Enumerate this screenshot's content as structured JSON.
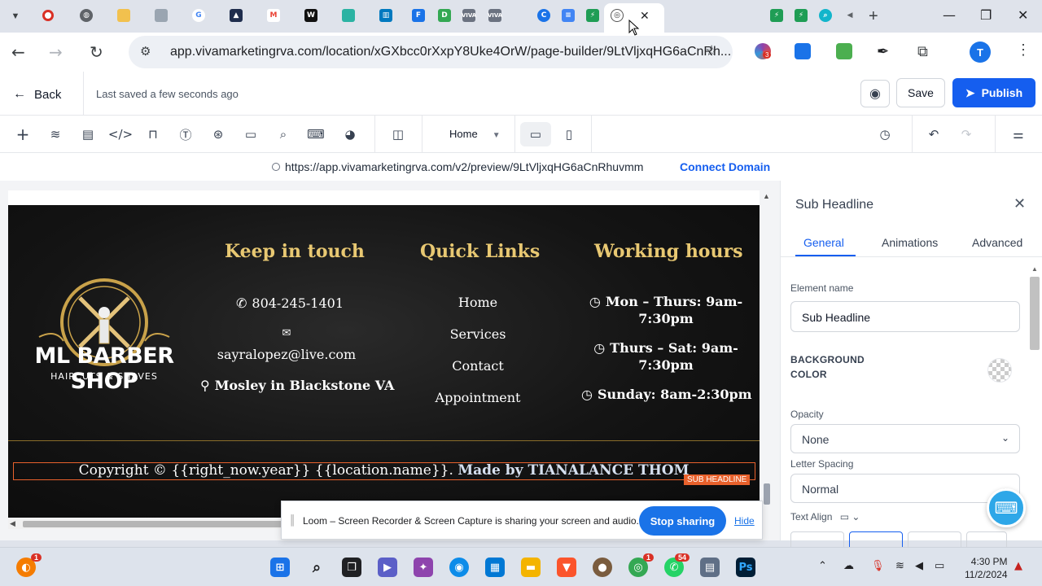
{
  "browser": {
    "url": "app.vivamarketingrva.com/location/xGXbcc0rXxpY8Uke4OrW/page-builder/9LtVljxqHG6aCnRh...",
    "profile_initial": "T",
    "extension_badge": "3"
  },
  "header": {
    "back_label": "Back",
    "last_saved": "Last saved a few seconds ago",
    "save_label": "Save",
    "publish_label": "Publish"
  },
  "toolbar": {
    "page_selected": "Home"
  },
  "preview": {
    "url": "https://app.vivamarketingrva.com/v2/preview/9LtVljxqHG6aCnRhuvmm",
    "connect_domain": "Connect Domain"
  },
  "site_footer": {
    "logo_title": "ML BARBER SHOP",
    "logo_subtitle": "HAIRCUTS & SHAVES",
    "keep_in_touch": {
      "title": "Keep in touch",
      "phone": "804-245-1401",
      "email": "sayralopez@live.com",
      "address": "Mosley in Blackstone VA"
    },
    "quick_links": {
      "title": "Quick Links",
      "items": [
        "Home",
        "Services",
        "Contact",
        "Appointment"
      ]
    },
    "working_hours": {
      "title": "Working hours",
      "line1a": "Mon – Thurs: 9am-",
      "line1b": "7:30pm",
      "line2a": "Thurs – Sat: 9am-",
      "line2b": "7:30pm",
      "line3": "Sunday: 8am-2:30pm"
    },
    "copyright_text": "Copyright © {{right_now.year}} {{location.name}}.",
    "made_by": "Made by TIANALANCE THOM",
    "sub_headline_tag": "SUB HEADLINE"
  },
  "panel": {
    "title": "Sub Headline",
    "tabs": [
      "General",
      "Animations",
      "Advanced"
    ],
    "element_name_label": "Element name",
    "element_name_value": "Sub Headline",
    "bg_color_label_1": "BACKGROUND",
    "bg_color_label_2": "COLOR",
    "opacity_label": "Opacity",
    "opacity_value": "None",
    "letter_spacing_label": "Letter Spacing",
    "letter_spacing_value": "Normal",
    "text_align_label": "Text Align"
  },
  "loom": {
    "message": "Loom – Screen Recorder & Screen Capture is sharing your screen and audio.",
    "stop_label": "Stop sharing",
    "hide_label": "Hide"
  },
  "taskbar": {
    "time": "4:30 PM",
    "date": "11/2/2024",
    "badge_edge": "1",
    "badge_chrome": "1",
    "badge_whatsapp": "54"
  }
}
